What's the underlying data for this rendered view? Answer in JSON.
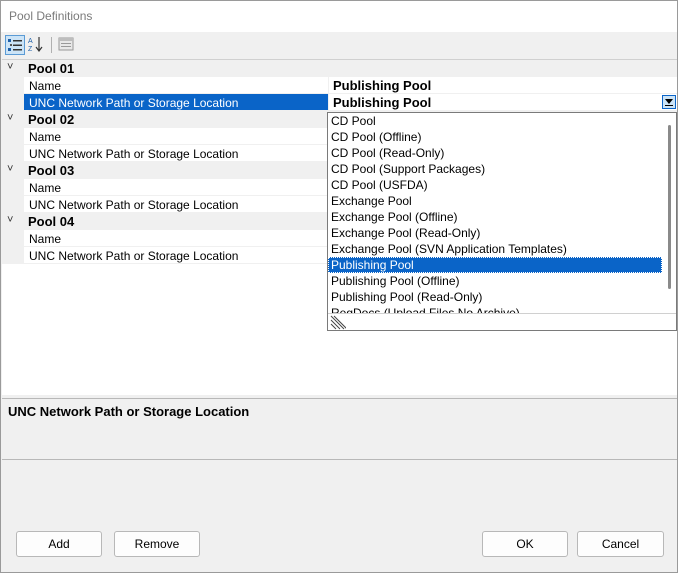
{
  "window": {
    "title": "Pool Definitions"
  },
  "toolbar": {
    "categorized_icon": "categorized-icon",
    "alphabetical_icon": "alphabetical-sort-icon",
    "property_pages_icon": "property-pages-icon"
  },
  "grid": {
    "categories": [
      {
        "label": "Pool 01",
        "name_label": "Name",
        "name_value": "Publishing Pool",
        "path_label": "UNC Network Path or Storage Location",
        "path_value": "Publishing Pool"
      },
      {
        "label": "Pool 02",
        "name_label": "Name",
        "name_value": "",
        "path_label": "UNC Network Path or Storage Location",
        "path_value": ""
      },
      {
        "label": "Pool 03",
        "name_label": "Name",
        "name_value": "",
        "path_label": "UNC Network Path or Storage Location",
        "path_value": ""
      },
      {
        "label": "Pool 04",
        "name_label": "Name",
        "name_value": "",
        "path_label": "UNC Network Path or Storage Location",
        "path_value": ""
      }
    ]
  },
  "dropdown": {
    "items": [
      "CD Pool",
      "CD Pool (Offline)",
      "CD Pool (Read-Only)",
      "CD Pool (Support Packages)",
      "CD Pool (USFDA)",
      "Exchange Pool",
      "Exchange Pool (Offline)",
      "Exchange Pool (Read-Only)",
      "Exchange Pool (SVN Application Templates)",
      "Publishing Pool",
      "Publishing Pool (Offline)",
      "Publishing Pool (Read-Only)",
      "RegDocs (Upload Files No Archive)"
    ],
    "selected": "Publishing Pool"
  },
  "help": {
    "title": "UNC Network Path or Storage Location"
  },
  "buttons": {
    "add": "Add",
    "remove": "Remove",
    "ok": "OK",
    "cancel": "Cancel"
  },
  "colors": {
    "selection": "#0a64c8",
    "background": "#f0f0f0"
  }
}
